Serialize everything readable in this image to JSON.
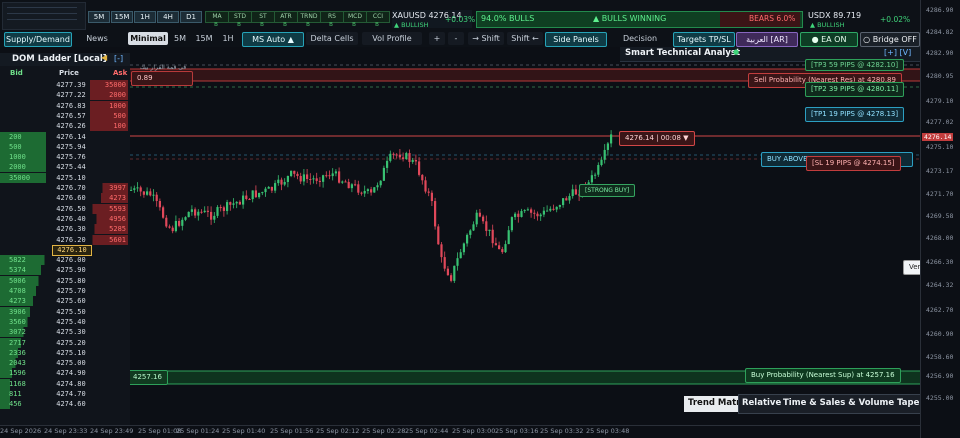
{
  "top_strip": {
    "timeframes_row1": [
      "5M",
      "15M",
      "1H",
      "4H",
      "D1"
    ],
    "indicators": [
      "MA",
      "STD",
      "ST",
      "ATR",
      "TRND",
      "RS",
      "MCD",
      "CCI"
    ],
    "indicator_value": "B",
    "symbol_price": "XAUUSD 4276.14",
    "symbol_change": "+0.03%",
    "symbol_trend": "▲ BULLISH",
    "bulls_pct": "94.0% BULLS",
    "bulls_winning": "▲ BULLS WINNING",
    "bears_pct": "BEARS 6.0%",
    "usdx_price": "USDX 89.719",
    "usdx_change": "+0.02%",
    "usdx_trend": "▲ BULLISH"
  },
  "toolbar": {
    "supply_demand": "Supply/Demand",
    "news": "News",
    "minimal": "Minimal",
    "tf_5m": "5M",
    "tf_15m": "15M",
    "tf_1h": "1H",
    "ms_auto": "MS Auto ▲",
    "delta_cells": "Delta Cells",
    "vol_profile": "Vol Profile",
    "plus": "+",
    "minus": "-",
    "shift_right": "→ Shift",
    "shift_left": "Shift ←",
    "side_panels": "Side Panels",
    "decision": "Decision",
    "targets": "Targets TP/SL",
    "arabic": "العربية [AR]",
    "ea_on": "● EA ON",
    "bridge_off": "○ Bridge OFF"
  },
  "dom": {
    "title": "DOM Ladder [Local]",
    "collapse": "[-]",
    "col_bid": "Bid",
    "col_price": "Price",
    "col_ask": "Ask",
    "current_price": "4276.10",
    "rows": [
      {
        "price": "4277.39",
        "bid": "",
        "ask": "35000"
      },
      {
        "price": "4277.22",
        "bid": "",
        "ask": "2000"
      },
      {
        "price": "4276.83",
        "bid": "",
        "ask": "1000"
      },
      {
        "price": "4276.57",
        "bid": "",
        "ask": "500"
      },
      {
        "price": "4276.26",
        "bid": "",
        "ask": "100"
      },
      {
        "price": "4276.14",
        "bid": "200",
        "ask": ""
      },
      {
        "price": "4275.94",
        "bid": "500",
        "ask": ""
      },
      {
        "price": "4275.76",
        "bid": "1000",
        "ask": ""
      },
      {
        "price": "4275.44",
        "bid": "2000",
        "ask": ""
      },
      {
        "price": "4275.10",
        "bid": "35000",
        "ask": ""
      },
      {
        "price": "4276.70",
        "bid": "",
        "ask": "3997"
      },
      {
        "price": "4276.60",
        "bid": "",
        "ask": "4273"
      },
      {
        "price": "4276.50",
        "bid": "",
        "ask": "5593"
      },
      {
        "price": "4276.40",
        "bid": "",
        "ask": "4956"
      },
      {
        "price": "4276.30",
        "bid": "",
        "ask": "5285"
      },
      {
        "price": "4276.20",
        "bid": "",
        "ask": "5601"
      },
      {
        "price": "4276.10",
        "bid": "",
        "ask": ""
      },
      {
        "price": "4276.00",
        "bid": "5822",
        "ask": ""
      },
      {
        "price": "4275.90",
        "bid": "5374",
        "ask": ""
      },
      {
        "price": "4275.80",
        "bid": "5006",
        "ask": ""
      },
      {
        "price": "4275.70",
        "bid": "4708",
        "ask": ""
      },
      {
        "price": "4275.60",
        "bid": "4273",
        "ask": ""
      },
      {
        "price": "4275.50",
        "bid": "3906",
        "ask": ""
      },
      {
        "price": "4275.40",
        "bid": "3560",
        "ask": ""
      },
      {
        "price": "4275.30",
        "bid": "3072",
        "ask": ""
      },
      {
        "price": "4275.20",
        "bid": "2717",
        "ask": ""
      },
      {
        "price": "4275.10",
        "bid": "2336",
        "ask": ""
      },
      {
        "price": "4275.00",
        "bid": "2043",
        "ask": ""
      },
      {
        "price": "4274.90",
        "bid": "1596",
        "ask": ""
      },
      {
        "price": "4274.80",
        "bid": "1168",
        "ask": ""
      },
      {
        "price": "4274.70",
        "bid": "811",
        "ask": ""
      },
      {
        "price": "4274.60",
        "bid": "456",
        "ask": ""
      }
    ]
  },
  "analyst": {
    "title": "Smart Technical Analyst",
    "status_dot": "●",
    "controls": "[+]  [V]",
    "tp3": "[TP3  59 PIPS @ 4282.10]",
    "sell_prob": "Sell Probability (Nearest Res) at 4280.89",
    "tp2": "[TP2  39 PIPS @ 4280.11]",
    "tp1": "[TP1  19 PIPS @ 4278.13]",
    "buy_above": "BUY ABOVE",
    "sl": "[SL  19 PIPS @ 4274.15]"
  },
  "chart": {
    "res_label": "0.89",
    "arabic_note": "فى قمة القرار بيك",
    "current_tag": "4276.14 | 00:08 ▼",
    "strong_buy": "[STRONG BUY]",
    "sup_label": "4257.16",
    "buy_prob": "Buy Probability (Nearest Sup) at 4257.16",
    "tooltip": "Vertical scale"
  },
  "bottom_panels": {
    "trend_matrix": "Trend Matr",
    "relative": "Relative",
    "time_sales": "Time & Sales & Volume Tape"
  },
  "price_axis": [
    "4286.90",
    "4284.82",
    "4282.90",
    "4280.95",
    "4279.10",
    "4277.02",
    "4276.14",
    "4275.10",
    "4273.17",
    "4271.70",
    "4269.58",
    "4268.00",
    "4266.30",
    "4264.32",
    "4262.70",
    "4260.90",
    "4258.60",
    "4256.90",
    "4255.00"
  ],
  "time_axis": [
    "24 Sep 2026",
    "24 Sep 23:33",
    "24 Sep 23:49",
    "25 Sep 01:08",
    "25 Sep 01:24",
    "25 Sep 01:40",
    "25 Sep 01:56",
    "25 Sep 02:12",
    "25 Sep 02:28",
    "25 Sep 02:44",
    "25 Sep 03:00",
    "25 Sep 03:16",
    "25 Sep 03:32",
    "25 Sep 03:48"
  ]
}
